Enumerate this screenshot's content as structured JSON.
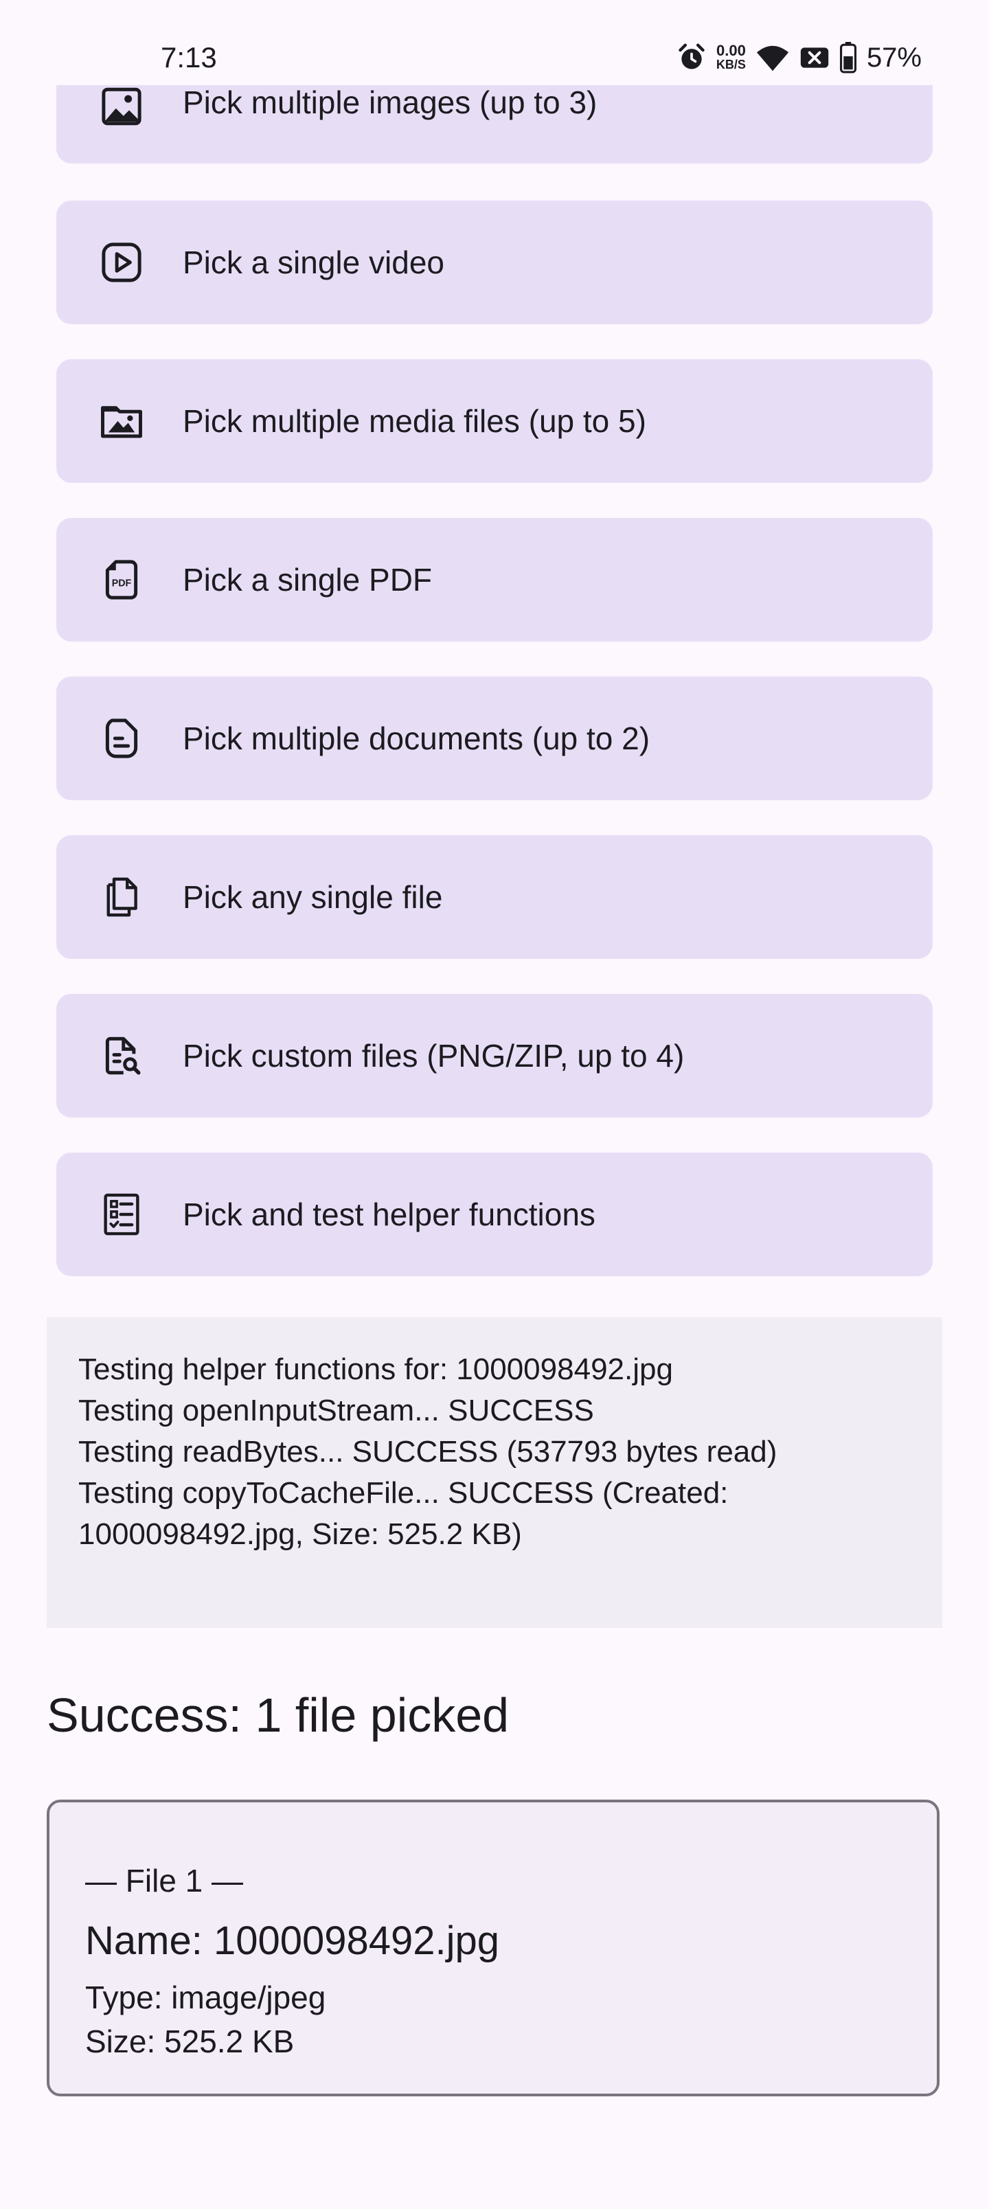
{
  "status_bar": {
    "time": "7:13",
    "net_speed_value": "0.00",
    "net_speed_unit": "KB/S",
    "battery_percent": "57%",
    "icons": [
      "alarm-icon",
      "wifi-icon",
      "no-sim-icon",
      "battery-icon"
    ]
  },
  "buttons": [
    {
      "label": "Pick multiple images (up to 3)",
      "icon": "image-icon"
    },
    {
      "label": "Pick a single video",
      "icon": "video-icon"
    },
    {
      "label": "Pick multiple media files (up to 5)",
      "icon": "media-folder-icon"
    },
    {
      "label": "Pick a single PDF",
      "icon": "pdf-icon",
      "icon_text": "PDF"
    },
    {
      "label": "Pick multiple documents (up to 2)",
      "icon": "document-icon"
    },
    {
      "label": "Pick any single file",
      "icon": "files-icon"
    },
    {
      "label": "Pick custom files (PNG/ZIP, up to 4)",
      "icon": "file-search-icon"
    },
    {
      "label": "Pick and test helper functions",
      "icon": "checklist-icon"
    }
  ],
  "log": {
    "lines": [
      "Testing helper functions for: 1000098492.jpg",
      "Testing openInputStream... SUCCESS",
      "Testing readBytes... SUCCESS (537793 bytes read)",
      "Testing copyToCacheFile... SUCCESS (Created:",
      "1000098492.jpg, Size: 525.2 KB)"
    ]
  },
  "result": {
    "title": "Success: 1 file picked",
    "file": {
      "header": "— File 1 —",
      "name": "Name: 1000098492.jpg",
      "type": "Type: image/jpeg",
      "size": "Size: 525.2 KB"
    }
  }
}
